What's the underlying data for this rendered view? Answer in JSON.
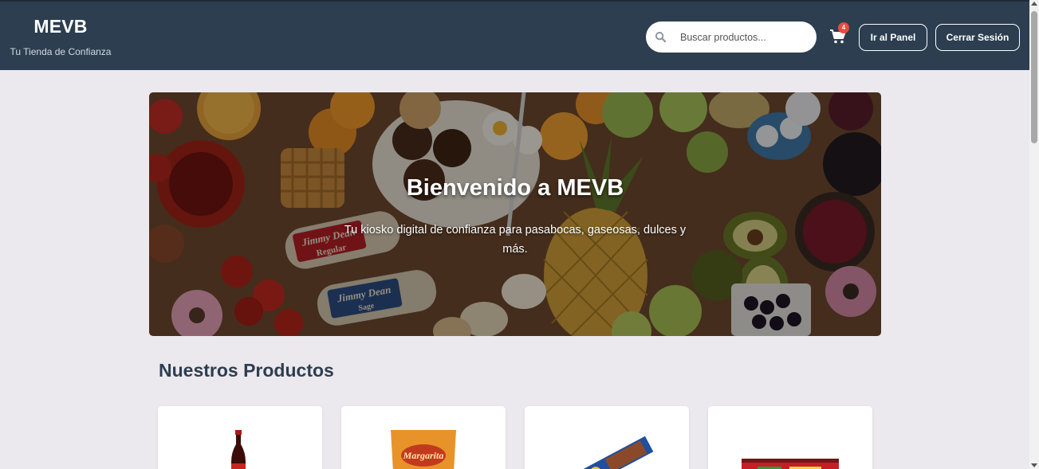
{
  "header": {
    "brand_title": "MEVB",
    "brand_subtitle": "Tu Tienda de Confianza",
    "search_placeholder": "Buscar productos...",
    "cart_count": "4",
    "panel_button": "Ir al Panel",
    "logout_button": "Cerrar Sesión"
  },
  "hero": {
    "title": "Bienvenido a MEVB",
    "subtitle": "Tu kiosko digital de confianza para pasabocas, gaseosas, dulces y más.",
    "sign_brand": "Jimmy Dean",
    "sign_regular": "Regular",
    "sign_sage": "Sage"
  },
  "products": {
    "section_title": "Nuestros Productos",
    "items": [
      {
        "image_icon": "soda-bottle-icon"
      },
      {
        "image_icon": "chips-bag-icon",
        "brand_text": "Margarita"
      },
      {
        "image_icon": "chocolate-bar-icon"
      },
      {
        "image_icon": "candy-pack-icon"
      }
    ]
  },
  "colors": {
    "header_bg": "#2c3e50",
    "page_bg": "#ece9ee",
    "badge": "#e74c3c",
    "heading": "#2c3e50"
  }
}
